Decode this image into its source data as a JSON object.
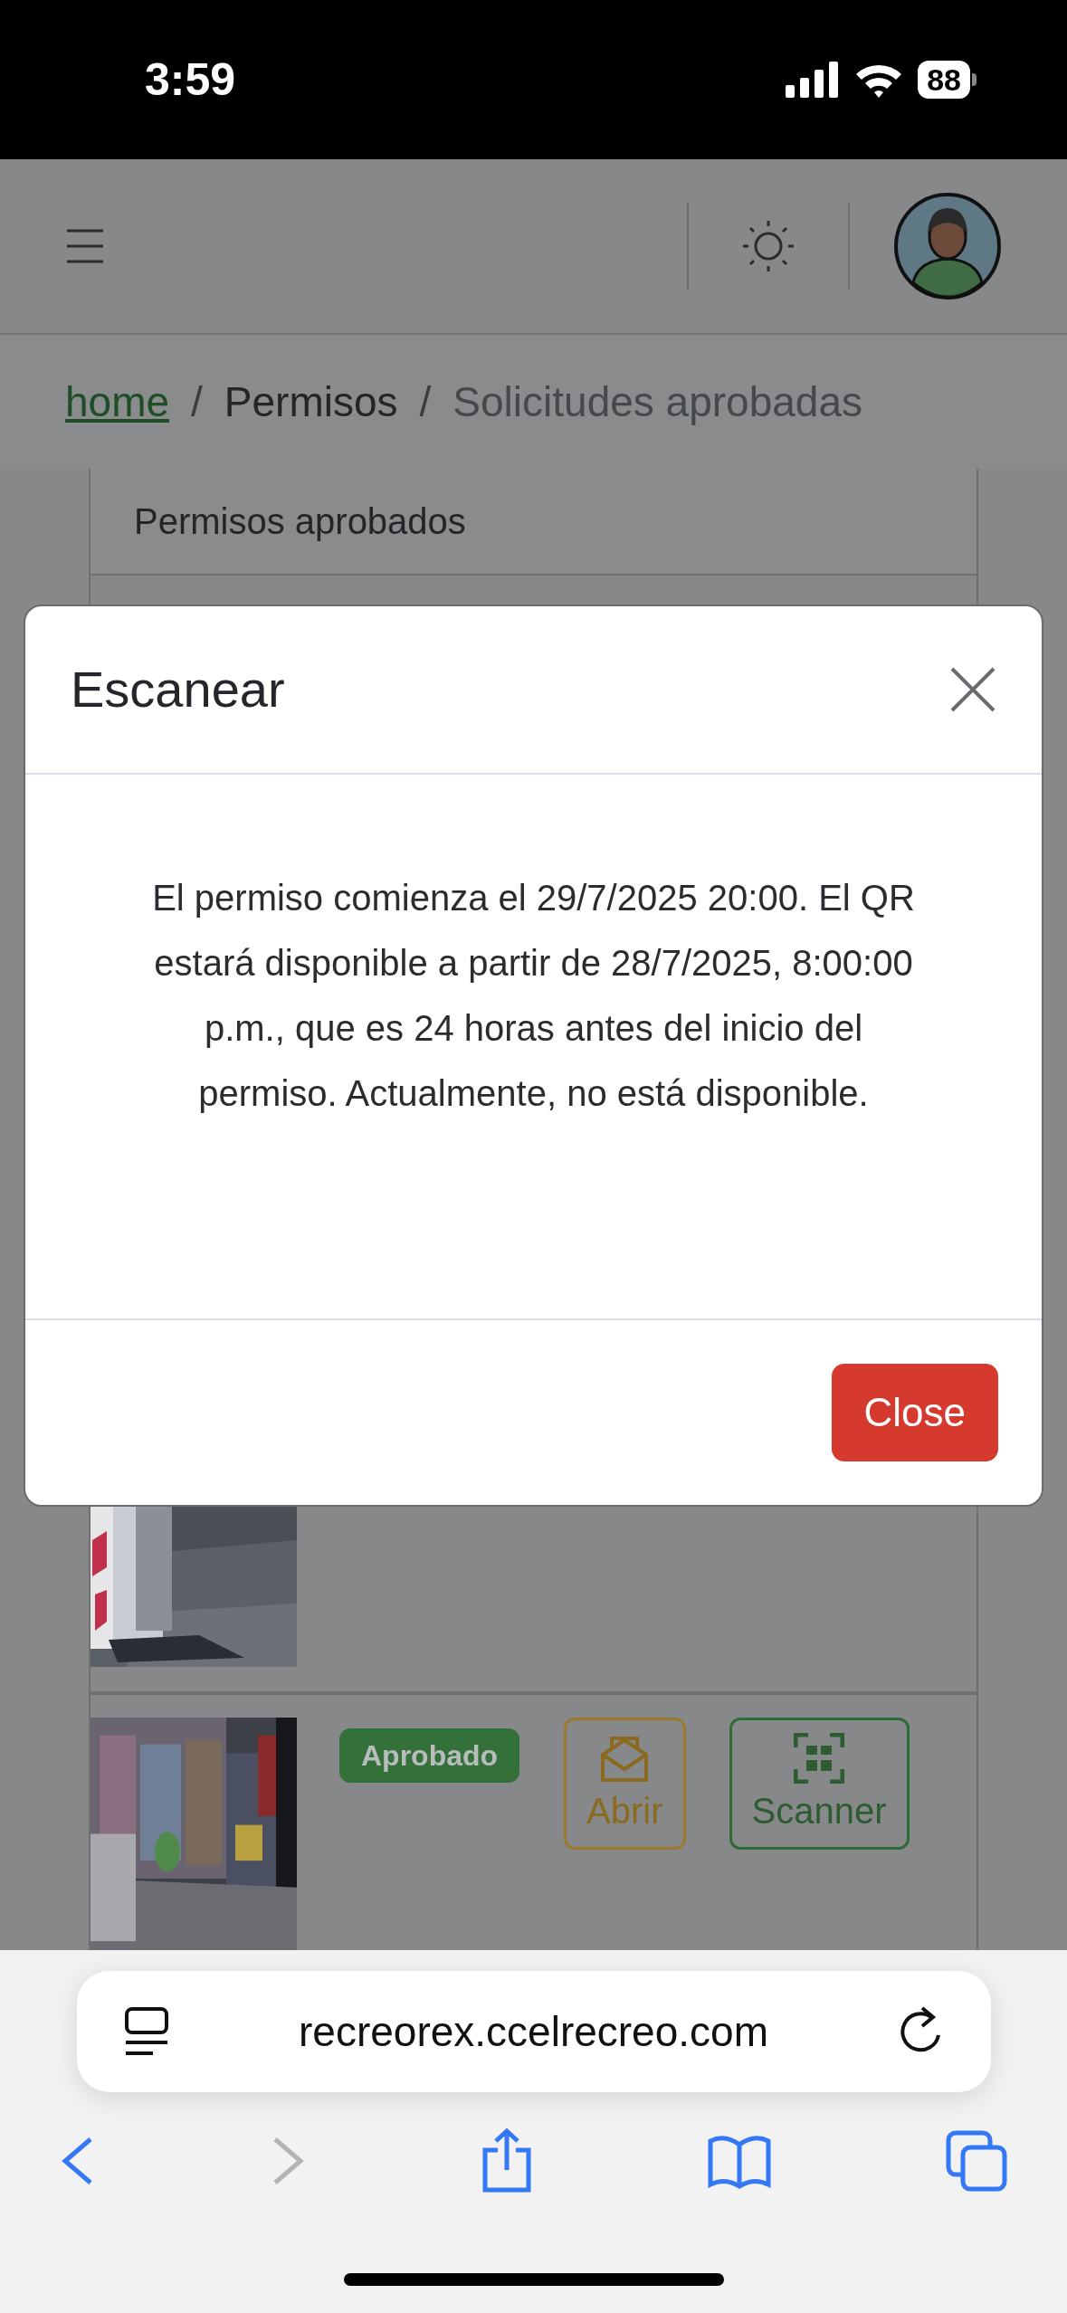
{
  "status_bar": {
    "time": "3:59",
    "battery": "88"
  },
  "breadcrumb_separator": "/",
  "breadcrumb": [
    {
      "label": "home",
      "kind": "link"
    },
    {
      "label": "Permisos",
      "kind": "item"
    },
    {
      "label": "Solicitudes aprobadas",
      "kind": "active"
    }
  ],
  "card": {
    "title": "Permisos aprobados",
    "rows": [
      {
        "kind": "picture"
      },
      {
        "kind": "permit",
        "badge": "Aprobado",
        "buttons": [
          {
            "label": "Abrir",
            "kind": "open"
          },
          {
            "label": "Scanner",
            "kind": "scan"
          }
        ]
      }
    ]
  },
  "modal": {
    "title": "Escanear",
    "message": "El permiso comienza el 29/7/2025 20:00. El QR estará disponible a partir de 28/7/2025, 8:00:00 p.m., que es 24 horas antes del inicio del permiso. Actualmente, no está disponible.",
    "button": "Close"
  },
  "browser": {
    "url": "recreorex.ccelrecreo.com"
  }
}
